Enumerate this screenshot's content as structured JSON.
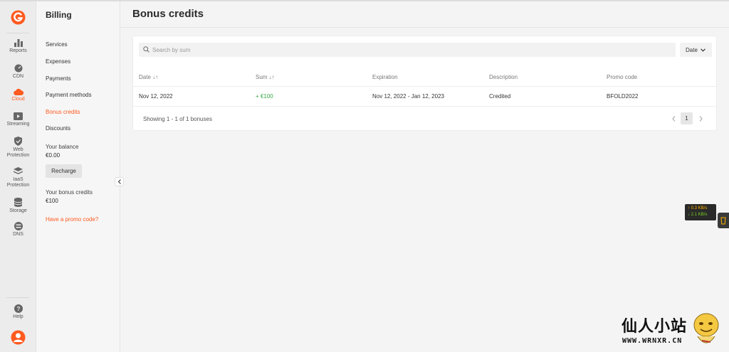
{
  "rail": {
    "items": [
      {
        "label": "Reports",
        "icon": "bar-chart-icon"
      },
      {
        "label": "CDN",
        "icon": "gauge-icon"
      },
      {
        "label": "Cloud",
        "icon": "cloud-icon",
        "active": true
      },
      {
        "label": "Streaming",
        "icon": "play-icon"
      },
      {
        "label": "Web Protection",
        "line1": "Web",
        "line2": "Protection",
        "icon": "shield-icon"
      },
      {
        "label": "IaaS Protection",
        "line1": "IaaS",
        "line2": "Protection",
        "icon": "layers-icon"
      },
      {
        "label": "Storage",
        "icon": "database-icon"
      },
      {
        "label": "DNS",
        "icon": "dns-icon"
      }
    ],
    "help_label": "Help"
  },
  "sidebar": {
    "title": "Billing",
    "items": [
      {
        "label": "Services"
      },
      {
        "label": "Expenses"
      },
      {
        "label": "Payments"
      },
      {
        "label": "Payment methods"
      },
      {
        "label": "Bonus credits",
        "active": true
      },
      {
        "label": "Discounts"
      }
    ],
    "balance_label": "Your balance",
    "balance_value": "€0.00",
    "recharge_label": "Recharge",
    "bonus_label": "Your bonus credits",
    "bonus_value": "€100",
    "promo_link": "Have a promo code?"
  },
  "main": {
    "title": "Bonus credits",
    "search_placeholder": "Search by sum",
    "date_filter_label": "Date",
    "columns": [
      "Date ↓↑",
      "Sum ↓↑",
      "Expiration",
      "Description",
      "Promo code"
    ],
    "rows": [
      {
        "date": "Nov 12, 2022",
        "sum": "+ €100",
        "expiration": "Nov 12, 2022 - Jan 12, 2023",
        "description": "Credited",
        "promo_code": "BFOLD2022"
      }
    ],
    "showing": "Showing 1 - 1 of 1 bonuses",
    "current_page": "1"
  },
  "widget": {
    "upload": "↑ 0.3 KB/s",
    "download": "↓ 2.1 KB/s"
  },
  "watermark": {
    "cn": "仙人小站",
    "url": "WWW.WRNXR.CN"
  },
  "colors": {
    "accent": "#ff5a1f",
    "positive": "#3aa845"
  }
}
